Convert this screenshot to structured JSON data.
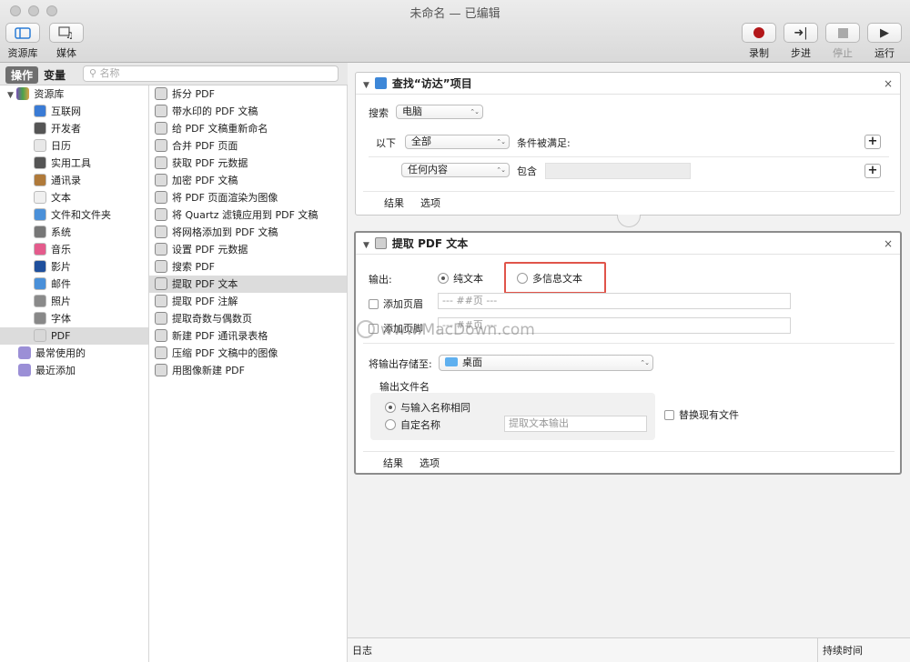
{
  "window": {
    "title": "未命名 — 已编辑"
  },
  "toolbar": {
    "library": "资源库",
    "media": "媒体",
    "record": "录制",
    "step": "步进",
    "stop": "停止",
    "run": "运行"
  },
  "tabs": {
    "actions": "操作",
    "variables": "变量"
  },
  "search": {
    "placeholder": "名称"
  },
  "library": {
    "root": "资源库",
    "items": [
      "互联网",
      "开发者",
      "日历",
      "实用工具",
      "通讯录",
      "文本",
      "文件和文件夹",
      "系统",
      "音乐",
      "影片",
      "邮件",
      "照片",
      "字体",
      "PDF"
    ],
    "selected": "PDF",
    "most_used": "最常使用的",
    "recent": "最近添加"
  },
  "actions_list": {
    "items": [
      "拆分 PDF",
      "带水印的 PDF 文稿",
      "给 PDF 文稿重新命名",
      "合并 PDF 页面",
      "获取 PDF 元数据",
      "加密 PDF 文稿",
      "将 PDF 页面渲染为图像",
      "将 Quartz 滤镜应用到 PDF 文稿",
      "将网格添加到 PDF 文稿",
      "设置 PDF 元数据",
      "搜索 PDF",
      "提取 PDF 文本",
      "提取 PDF 注解",
      "提取奇数与偶数页",
      "新建 PDF 通讯录表格",
      "压缩 PDF 文稿中的图像",
      "用图像新建 PDF"
    ],
    "selected": "提取 PDF 文本"
  },
  "card1": {
    "title": "查找“访达”项目",
    "search_label": "搜索",
    "search_value": "电脑",
    "following_label": "以下",
    "following_value": "全部",
    "condition_label": "条件被满足:",
    "criteria_value": "任何内容",
    "contains_label": "包含",
    "tab_results": "结果",
    "tab_options": "选项"
  },
  "card2": {
    "title": "提取 PDF 文本",
    "output_label": "输出:",
    "plain_text": "纯文本",
    "rich_text": "多信息文本",
    "add_header": "添加页眉",
    "header_placeholder": "--- ##页 ---",
    "add_footer": "添加页脚",
    "footer_placeholder": "--- ##页 ---",
    "save_to_label": "将输出存储至:",
    "save_to_value": "桌面",
    "filename_group": "输出文件名",
    "same_as_input": "与输入名称相同",
    "custom_name": "自定名称",
    "custom_placeholder": "提取文本输出",
    "replace_existing": "替换现有文件",
    "tab_results": "结果",
    "tab_options": "选项"
  },
  "log": {
    "log_label": "日志",
    "duration_label": "持续时间"
  },
  "watermark": "www.MacDown.com"
}
